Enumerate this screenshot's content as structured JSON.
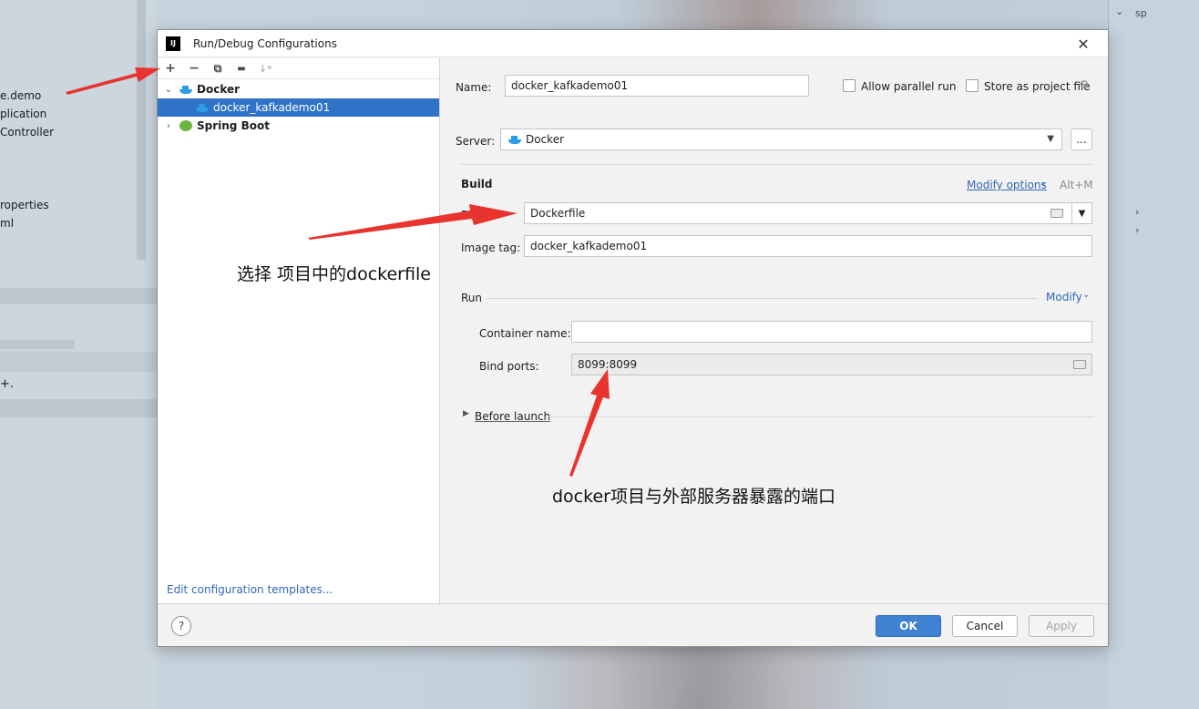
{
  "background": {
    "left_items": [
      "e.demo",
      "plication",
      "Controller",
      "roperties",
      "ml"
    ],
    "right_items": [
      "sp"
    ]
  },
  "dialog": {
    "title": "Run/Debug Configurations",
    "close_icon": "close-icon"
  },
  "toolbar": {
    "add": "+",
    "remove": "−",
    "copy": "⧉",
    "folder": "▬",
    "sort": "↓ᵃ"
  },
  "tree": {
    "docker_group": "Docker",
    "docker_item": "docker_kafkademo01",
    "spring_group": "Spring Boot"
  },
  "templates_link": "Edit configuration templates...",
  "form": {
    "name_label": "Name:",
    "name_value": "docker_kafkademo01",
    "allow_parallel_label": "Allow parallel run",
    "store_project_label": "Store as project file",
    "server_label": "Server:",
    "server_value": "Docker",
    "browse_label": "...",
    "build_title": "Build",
    "modify_options": "Modify options",
    "modify_shortcut": "Alt+M",
    "dockerfile_label": "Docke",
    "dockerfile_value": "Dockerfile",
    "image_tag_label": "Image tag:",
    "image_tag_value": "docker_kafkademo01",
    "run_title": "Run",
    "modify_link": "Modify",
    "container_name_label": "Container name:",
    "container_name_value": "",
    "bind_ports_label": "Bind ports:",
    "bind_ports_value": "8099:8099",
    "before_launch": "Before launch"
  },
  "footer": {
    "help": "?",
    "ok": "OK",
    "cancel": "Cancel",
    "apply": "Apply"
  },
  "annotations": {
    "dockerfile_note": "选择 项目中的dockerfile",
    "ports_note": "docker项目与外部服务器暴露的端口"
  },
  "colors": {
    "selection": "#2e73c7",
    "link": "#2f67b5",
    "primary_button": "#3f82d2",
    "arrow": "#e8332e"
  }
}
